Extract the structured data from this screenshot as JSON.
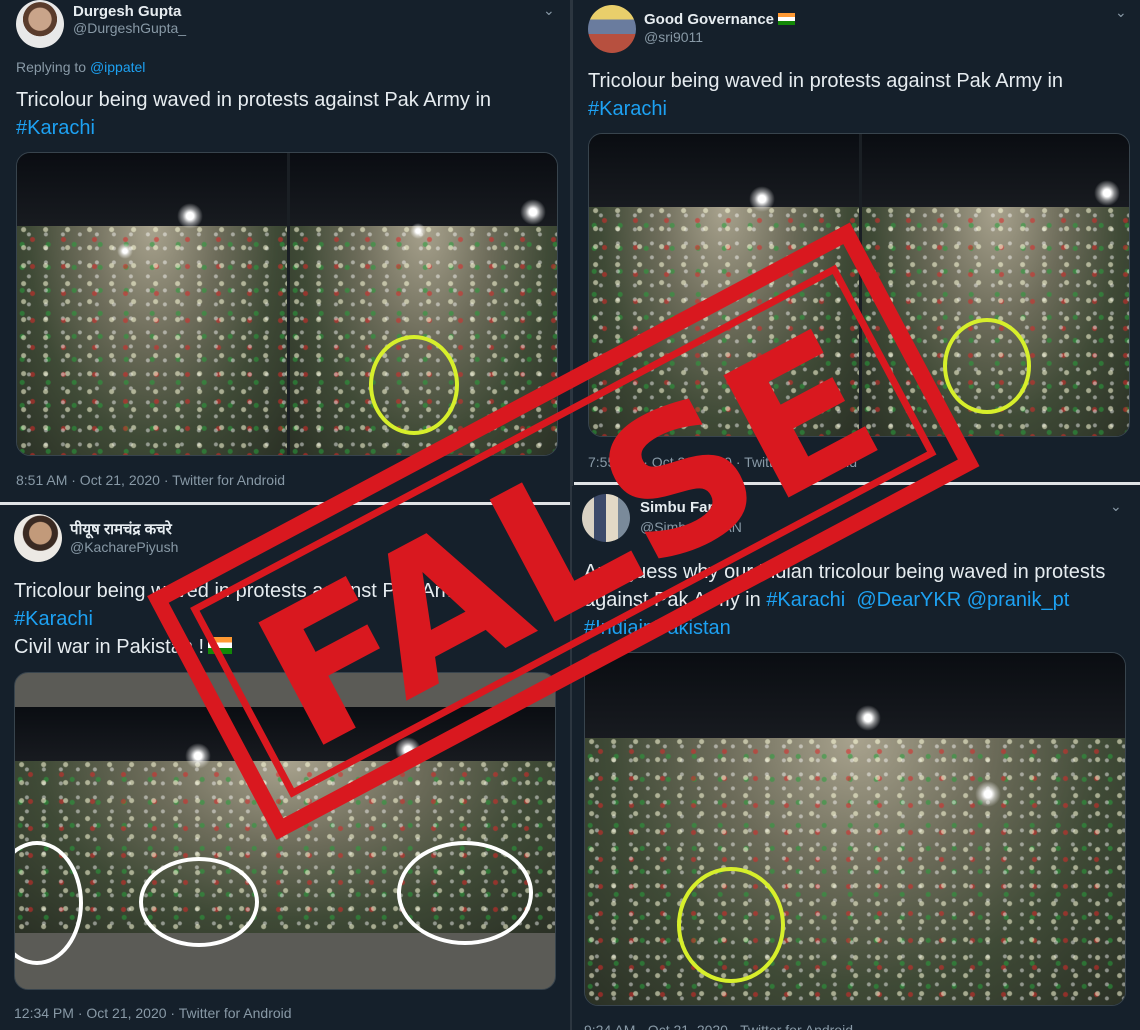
{
  "tweets": [
    {
      "name": "Durgesh Gupta",
      "handle": "@DurgeshGupta_",
      "replying_prefix": "Replying to ",
      "replying_to": "@ippatel",
      "text": "Tricolour being waved in protests against Pak Army in",
      "hashtag": "#Karachi",
      "meta": "8:51 AM · Oct 21, 2020 · Twitter for Android"
    },
    {
      "name": "Good Governance",
      "handle": "@sri9011",
      "text": "Tricolour being waved in protests against Pak Army in",
      "hashtag": "#Karachi",
      "meta": "7:55 AM · Oct 21, 2020 · Twitter for Android"
    },
    {
      "name": "पीयूष रामचंद्र कचरे",
      "handle": "@KacharePiyush",
      "text": "Tricolour being waved in protests against Pak Army in",
      "hashtag": "#Karachi",
      "text2": "Civil war in Pakistan !",
      "meta": "12:34 PM · Oct 21, 2020 · Twitter for Android"
    },
    {
      "name": "Simbu Fans",
      "handle": "@SimbuMSTAN",
      "text": "Any guess why our Indian tricolour being waved in protests against Pak Army in",
      "hashtag": "#Karachi",
      "mention1": "@DearYKR",
      "mention2": "@pranik_pt",
      "hashtag2": "#IndiainPakistan",
      "meta": "9:24 AM · Oct 21, 2020 · Twitter for Android"
    }
  ],
  "stamp": {
    "label": "FALSE",
    "color": "#d9181f"
  },
  "icons": {
    "menu": "chevron-down-icon",
    "flag": "india-flag-icon"
  }
}
